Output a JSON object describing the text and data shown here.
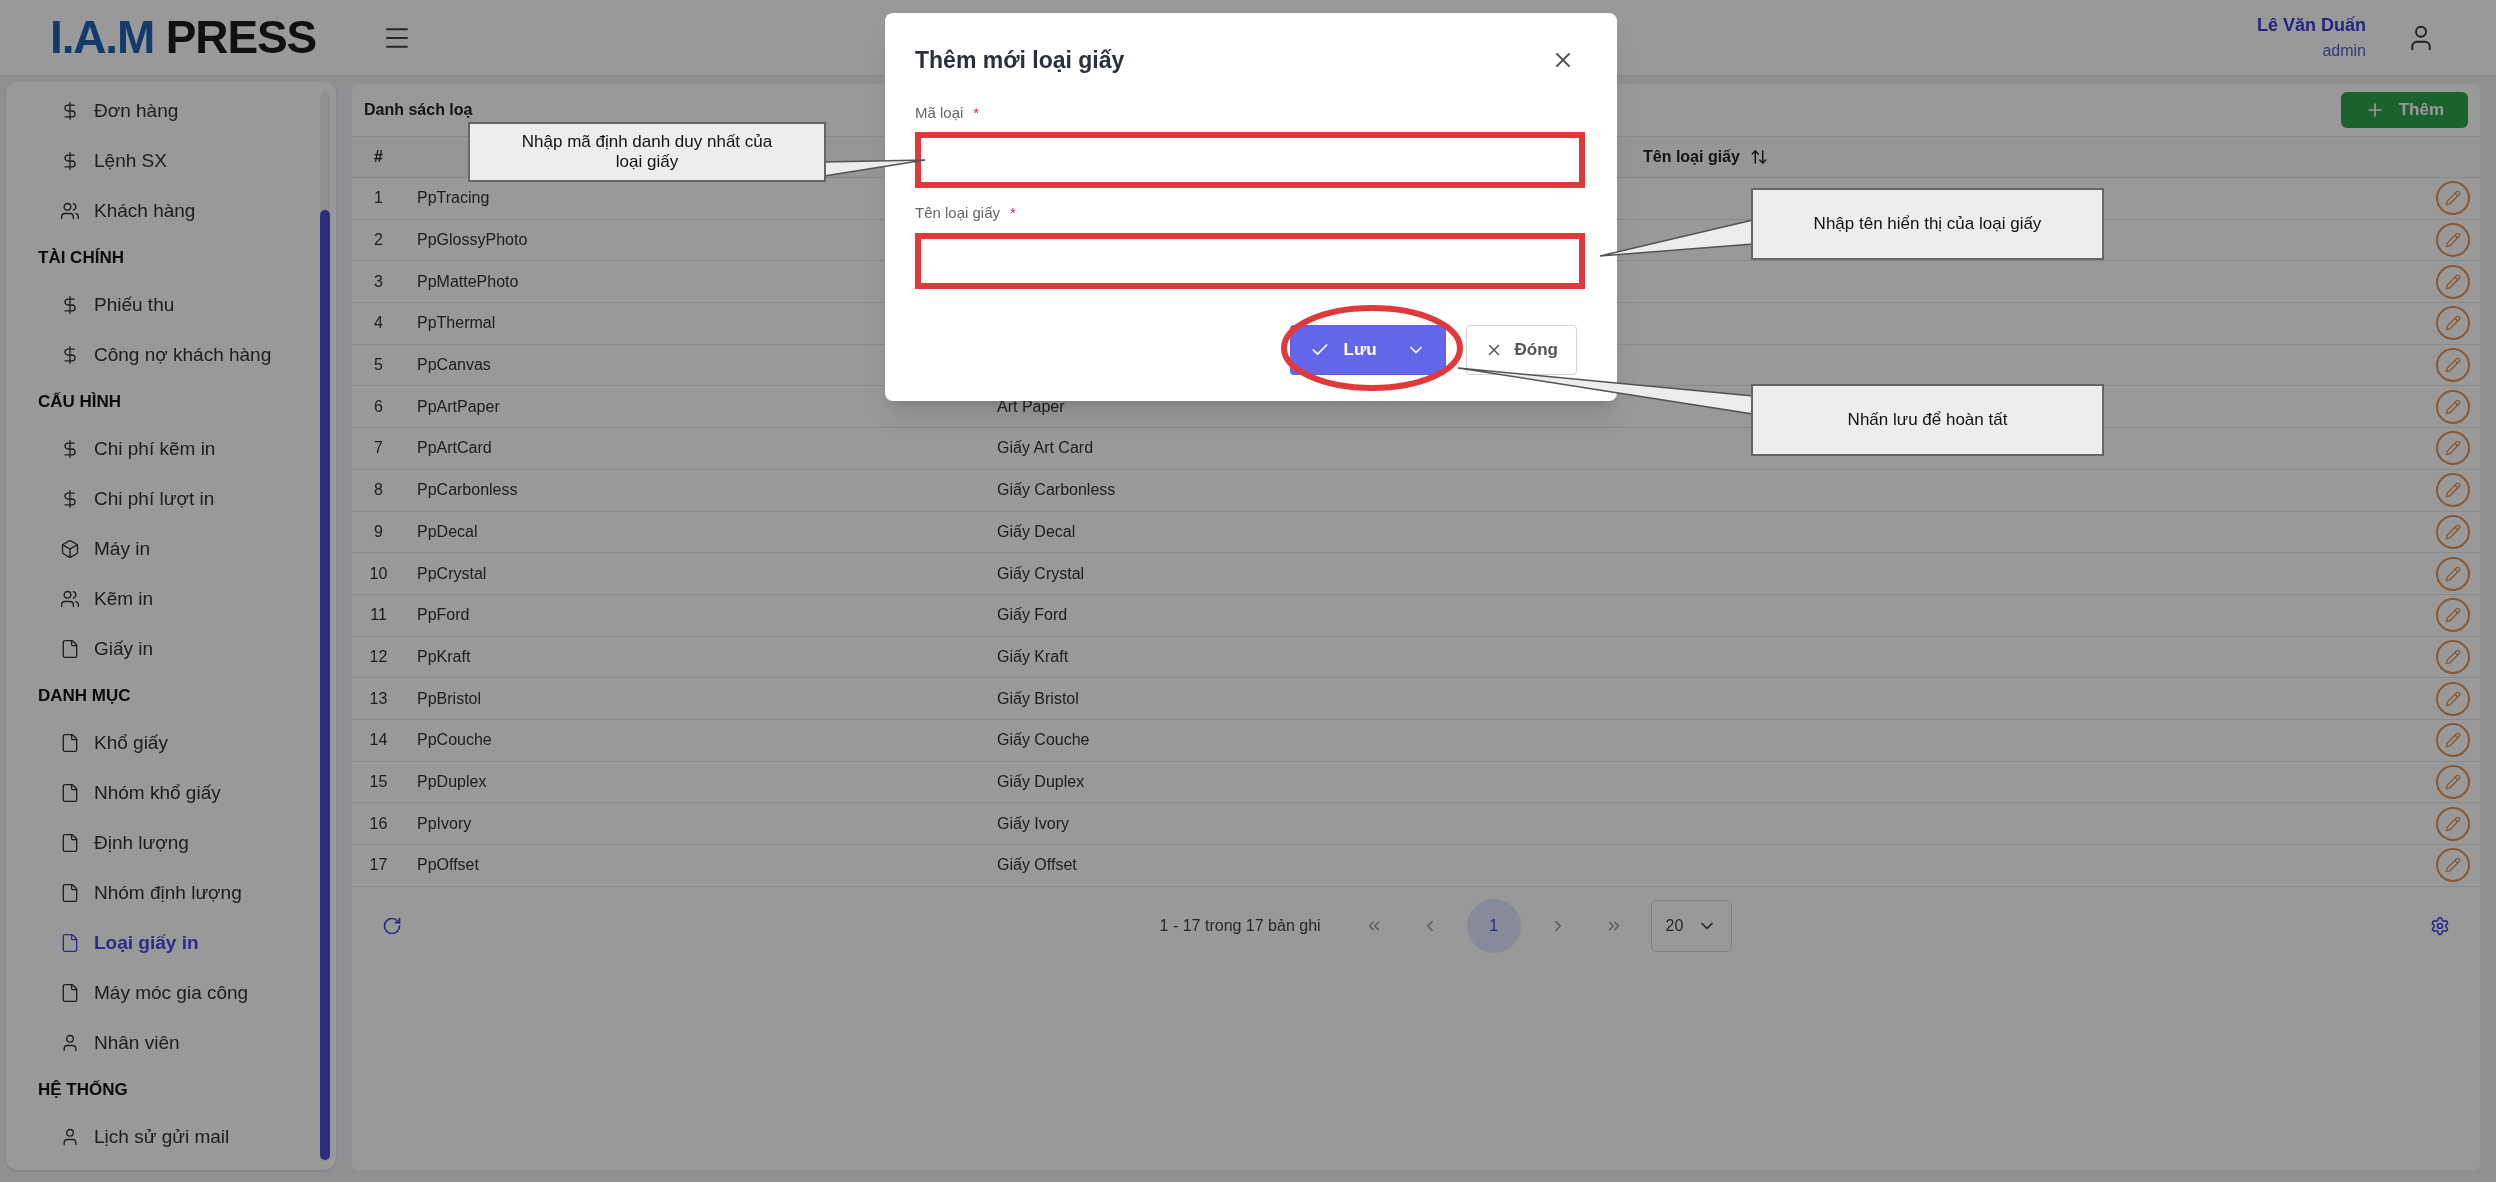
{
  "header": {
    "logo": {
      "mark": "I.A.M",
      "word": "PRESS"
    },
    "user": {
      "name": "Lê Văn Duấn",
      "role": "admin"
    }
  },
  "sidebar": {
    "sections": [
      {
        "items": [
          {
            "label": "Đơn hàng",
            "kind": "dollar",
            "selected": false
          },
          {
            "label": "Lệnh SX",
            "kind": "dollar",
            "selected": false
          },
          {
            "label": "Khách hàng",
            "kind": "users",
            "selected": false
          }
        ]
      },
      {
        "title": "TÀI CHÍNH",
        "items": [
          {
            "label": "Phiếu thu",
            "kind": "dollar",
            "selected": false
          },
          {
            "label": "Công nợ khách hàng",
            "kind": "dollar",
            "selected": false
          }
        ]
      },
      {
        "title": "CẤU HÌNH",
        "items": [
          {
            "label": "Chi phí kẽm in",
            "kind": "dollar",
            "selected": false
          },
          {
            "label": "Chi phí lượt in",
            "kind": "dollar",
            "selected": false
          },
          {
            "label": "Máy in",
            "kind": "box",
            "selected": false
          },
          {
            "label": "Kẽm in",
            "kind": "users",
            "selected": false
          },
          {
            "label": "Giấy in",
            "kind": "file",
            "selected": false
          }
        ]
      },
      {
        "title": "DANH MỤC",
        "items": [
          {
            "label": "Khổ giấy",
            "kind": "file",
            "selected": false
          },
          {
            "label": "Nhóm khổ giấy",
            "kind": "file",
            "selected": false
          },
          {
            "label": "Định lượng",
            "kind": "file",
            "selected": false
          },
          {
            "label": "Nhóm định lượng",
            "kind": "file",
            "selected": false
          },
          {
            "label": "Loại giấy in",
            "kind": "file",
            "selected": true
          },
          {
            "label": "Máy móc gia công",
            "kind": "file",
            "selected": false
          },
          {
            "label": "Nhân viên",
            "kind": "user",
            "selected": false
          }
        ]
      },
      {
        "title": "HỆ THỐNG",
        "items": [
          {
            "label": "Lịch sử gửi mail",
            "kind": "user",
            "selected": false
          }
        ]
      }
    ]
  },
  "table": {
    "title": "Danh sách loạ",
    "add_button": "Thêm",
    "columns": {
      "index": "#",
      "name": "Tên loại giấy"
    },
    "rows": [
      {
        "no": "1",
        "code": "PpTracing"
      },
      {
        "no": "2",
        "code": "PpGlossyPhoto"
      },
      {
        "no": "3",
        "code": "PpMattePhoto"
      },
      {
        "no": "4",
        "code": "PpThermal"
      },
      {
        "no": "5",
        "code": "PpCanvas"
      },
      {
        "no": "6",
        "code": "PpArtPaper",
        "name": "Art Paper"
      },
      {
        "no": "7",
        "code": "PpArtCard",
        "name": "Giấy Art Card"
      },
      {
        "no": "8",
        "code": "PpCarbonless",
        "name": "Giấy Carbonless"
      },
      {
        "no": "9",
        "code": "PpDecal",
        "name": "Giấy Decal"
      },
      {
        "no": "10",
        "code": "PpCrystal",
        "name": "Giấy Crystal"
      },
      {
        "no": "11",
        "code": "PpFord",
        "name": "Giấy Ford"
      },
      {
        "no": "12",
        "code": "PpKraft",
        "name": "Giấy Kraft"
      },
      {
        "no": "13",
        "code": "PpBristol",
        "name": "Giấy Bristol"
      },
      {
        "no": "14",
        "code": "PpCouche",
        "name": "Giấy Couche"
      },
      {
        "no": "15",
        "code": "PpDuplex",
        "name": "Giấy Duplex"
      },
      {
        "no": "16",
        "code": "PpIvory",
        "name": "Giấy Ivory"
      },
      {
        "no": "17",
        "code": "PpOffset",
        "name": "Giấy Offset"
      }
    ],
    "pagination": {
      "summary": "1 - 17 trong 17 bản ghi",
      "pages": [
        {
          "label": "1",
          "selected": true
        }
      ],
      "page_size": "20"
    }
  },
  "modal": {
    "title": "Thêm mới loại giấy",
    "fields": [
      {
        "label": "Mã loại",
        "required_mark": "*"
      },
      {
        "label": "Tên loại giấy",
        "required_mark": "*"
      }
    ],
    "buttons": [
      {
        "kind": "primary",
        "label": "Lưu"
      },
      {
        "kind": "secondary",
        "label": "Đóng"
      }
    ]
  },
  "callouts": [
    {
      "text": "Nhập mã định danh duy nhất của loại giấy"
    },
    {
      "text": "Nhập tên hiển thị của loại giấy"
    },
    {
      "text": "Nhấn lưu để hoàn tất"
    }
  ]
}
